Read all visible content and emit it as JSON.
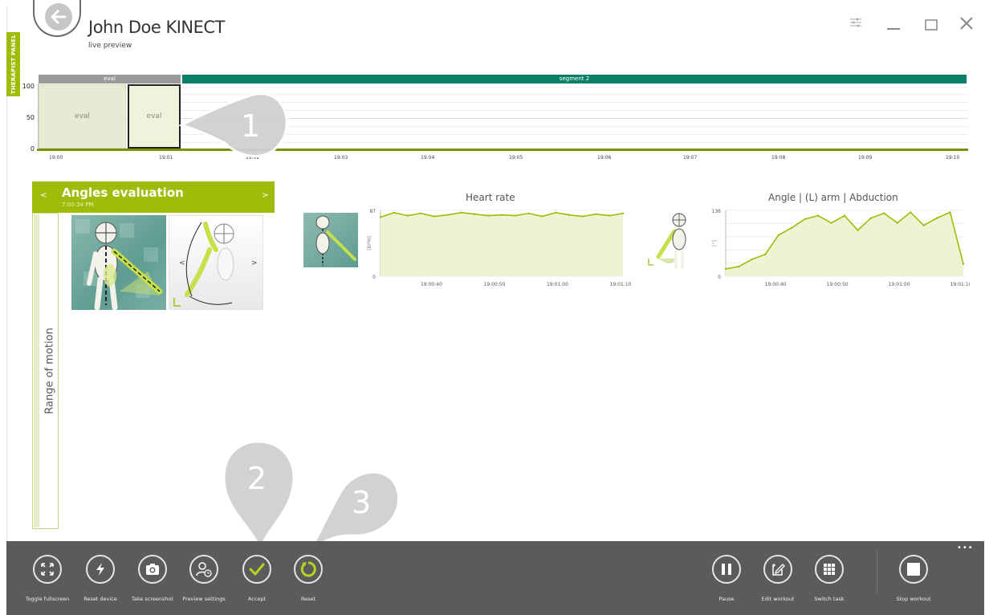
{
  "header": {
    "title": "John Doe KINECT",
    "subtitle": "live preview",
    "therapist_tab": "THERAPIST PANEL"
  },
  "timeline": {
    "segments": [
      {
        "label": "eval",
        "color": "#9b9b9b"
      },
      {
        "label": "segment 2",
        "color": "#0b8068"
      }
    ],
    "y_ticks": [
      "100",
      "50",
      "0"
    ],
    "x_ticks": [
      "19:00",
      "19:01",
      "19:02",
      "19:03",
      "19:04",
      "19:05",
      "19:06",
      "19:07",
      "19:08",
      "19:09",
      "19:10"
    ],
    "eval_blocks": [
      "eval",
      "eval"
    ]
  },
  "exercise": {
    "title": "Angles evaluation",
    "time": "7:00:34 PM",
    "prev": "<",
    "next": ">",
    "rom_label": "Range of motion",
    "thumb_prev": "<",
    "thumb_next": ">"
  },
  "callouts": [
    "1",
    "2",
    "3"
  ],
  "chart_data": [
    {
      "type": "line",
      "title": "Heart rate",
      "ylabel": "[BPM]",
      "ylim": [
        0,
        87
      ],
      "y_ticks": [
        "87",
        "0"
      ],
      "x_ticks": [
        "19:00:40",
        "19:00:50",
        "19:01:00",
        "19:01:10"
      ],
      "x": [
        "19:00:34",
        "19:00:36",
        "19:00:38",
        "19:00:40",
        "19:00:42",
        "19:00:44",
        "19:00:46",
        "19:00:48",
        "19:00:50",
        "19:00:52",
        "19:00:54",
        "19:00:56",
        "19:00:58",
        "19:01:00",
        "19:01:02",
        "19:01:04",
        "19:01:06",
        "19:01:08",
        "19:01:10"
      ],
      "values": [
        78,
        84,
        80,
        83,
        79,
        81,
        84,
        82,
        80,
        81,
        80,
        83,
        79,
        84,
        81,
        79,
        82,
        80,
        83
      ],
      "color": "#9dbd0a"
    },
    {
      "type": "line",
      "title": "Angle | (L) arm | Abduction",
      "ylabel": "[°]",
      "ylim": [
        0,
        136
      ],
      "y_ticks": [
        "136",
        "0"
      ],
      "x_ticks": [
        "19:00:40",
        "19:00:50",
        "19:01:00",
        "19:01:10"
      ],
      "x": [
        "19:00:34",
        "19:00:36",
        "19:00:38",
        "19:00:40",
        "19:00:42",
        "19:00:44",
        "19:00:46",
        "19:00:48",
        "19:00:50",
        "19:00:52",
        "19:00:54",
        "19:00:56",
        "19:00:58",
        "19:01:00",
        "19:01:02",
        "19:01:04",
        "19:01:06",
        "19:01:08",
        "19:01:10"
      ],
      "values": [
        15,
        20,
        35,
        45,
        85,
        100,
        118,
        125,
        110,
        125,
        95,
        120,
        130,
        110,
        132,
        105,
        120,
        132,
        25
      ],
      "color": "#9dbd0a"
    }
  ],
  "toolbar": {
    "left": [
      {
        "label": "Toggle fullscreen",
        "icon": "fullscreen-icon"
      },
      {
        "label": "Reset device",
        "icon": "lightning-icon"
      },
      {
        "label": "Take screenshot",
        "icon": "camera-icon"
      },
      {
        "label": "Preview settings",
        "icon": "user-clock-icon"
      },
      {
        "label": "Accept",
        "icon": "check-icon"
      },
      {
        "label": "Reset",
        "icon": "reset-icon"
      }
    ],
    "right": [
      {
        "label": "Pause",
        "icon": "pause-icon"
      },
      {
        "label": "Edit workout",
        "icon": "edit-icon"
      },
      {
        "label": "Switch task",
        "icon": "grid-icon"
      },
      {
        "label": "Stop workout",
        "icon": "stop-icon"
      }
    ],
    "more": "•••"
  },
  "colors": {
    "accent": "#9dbd0a",
    "teal": "#0b8068",
    "toolbar_bg": "#5b5b5b"
  }
}
